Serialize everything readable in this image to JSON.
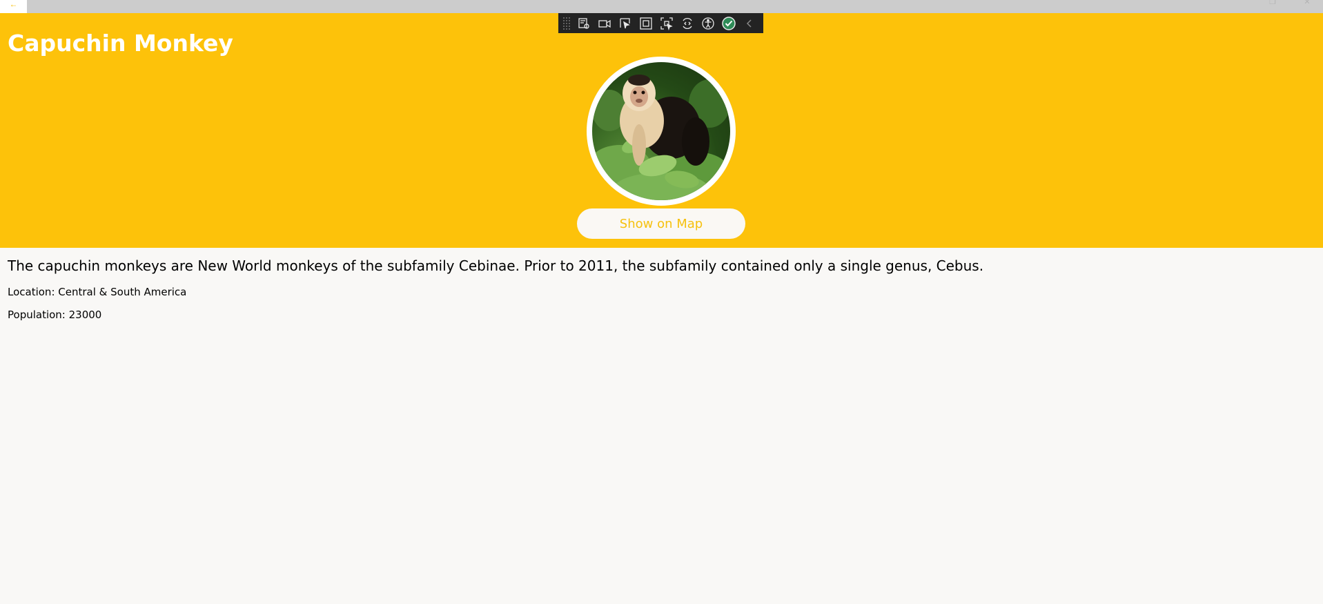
{
  "window": {
    "back_icon": "back-arrow-icon",
    "controls": [
      "restore-icon",
      "close-icon"
    ]
  },
  "header": {
    "title": "Capuchin Monkey",
    "background_color": "#fdc20a"
  },
  "dev_toolbar": {
    "buttons": [
      "live-visual-tree-icon",
      "track-focus-icon",
      "select-element-icon",
      "display-layout-adorners-icon",
      "track-focus-rect-icon",
      "hot-reload-icon",
      "accessibility-icon",
      "status-check-icon",
      "collapse-chevron-icon"
    ]
  },
  "animal": {
    "image_alt": "Capuchin monkey photo",
    "map_button_label": "Show on Map",
    "description": "The capuchin monkeys are New World monkeys of the subfamily Cebinae. Prior to 2011, the subfamily contained only a single genus, Cebus.",
    "location": "Location: Central & South America",
    "population": "Population: 23000"
  },
  "colors": {
    "accent": "#fdc20a",
    "page_background": "#f9f8f6",
    "button_text": "#f6c10e"
  }
}
